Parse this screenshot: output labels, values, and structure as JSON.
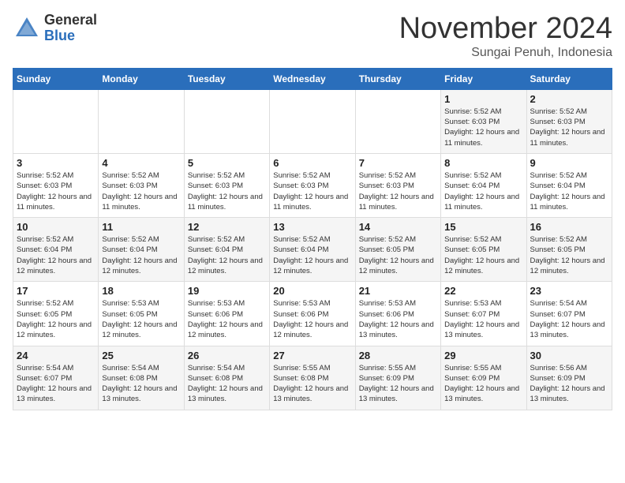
{
  "header": {
    "logo_general": "General",
    "logo_blue": "Blue",
    "month_title": "November 2024",
    "subtitle": "Sungai Penuh, Indonesia"
  },
  "days_of_week": [
    "Sunday",
    "Monday",
    "Tuesday",
    "Wednesday",
    "Thursday",
    "Friday",
    "Saturday"
  ],
  "weeks": [
    [
      {
        "day": "",
        "info": ""
      },
      {
        "day": "",
        "info": ""
      },
      {
        "day": "",
        "info": ""
      },
      {
        "day": "",
        "info": ""
      },
      {
        "day": "",
        "info": ""
      },
      {
        "day": "1",
        "info": "Sunrise: 5:52 AM\nSunset: 6:03 PM\nDaylight: 12 hours\nand 11 minutes."
      },
      {
        "day": "2",
        "info": "Sunrise: 5:52 AM\nSunset: 6:03 PM\nDaylight: 12 hours\nand 11 minutes."
      }
    ],
    [
      {
        "day": "3",
        "info": "Sunrise: 5:52 AM\nSunset: 6:03 PM\nDaylight: 12 hours\nand 11 minutes."
      },
      {
        "day": "4",
        "info": "Sunrise: 5:52 AM\nSunset: 6:03 PM\nDaylight: 12 hours\nand 11 minutes."
      },
      {
        "day": "5",
        "info": "Sunrise: 5:52 AM\nSunset: 6:03 PM\nDaylight: 12 hours\nand 11 minutes."
      },
      {
        "day": "6",
        "info": "Sunrise: 5:52 AM\nSunset: 6:03 PM\nDaylight: 12 hours\nand 11 minutes."
      },
      {
        "day": "7",
        "info": "Sunrise: 5:52 AM\nSunset: 6:03 PM\nDaylight: 12 hours\nand 11 minutes."
      },
      {
        "day": "8",
        "info": "Sunrise: 5:52 AM\nSunset: 6:04 PM\nDaylight: 12 hours\nand 11 minutes."
      },
      {
        "day": "9",
        "info": "Sunrise: 5:52 AM\nSunset: 6:04 PM\nDaylight: 12 hours\nand 11 minutes."
      }
    ],
    [
      {
        "day": "10",
        "info": "Sunrise: 5:52 AM\nSunset: 6:04 PM\nDaylight: 12 hours\nand 12 minutes."
      },
      {
        "day": "11",
        "info": "Sunrise: 5:52 AM\nSunset: 6:04 PM\nDaylight: 12 hours\nand 12 minutes."
      },
      {
        "day": "12",
        "info": "Sunrise: 5:52 AM\nSunset: 6:04 PM\nDaylight: 12 hours\nand 12 minutes."
      },
      {
        "day": "13",
        "info": "Sunrise: 5:52 AM\nSunset: 6:04 PM\nDaylight: 12 hours\nand 12 minutes."
      },
      {
        "day": "14",
        "info": "Sunrise: 5:52 AM\nSunset: 6:05 PM\nDaylight: 12 hours\nand 12 minutes."
      },
      {
        "day": "15",
        "info": "Sunrise: 5:52 AM\nSunset: 6:05 PM\nDaylight: 12 hours\nand 12 minutes."
      },
      {
        "day": "16",
        "info": "Sunrise: 5:52 AM\nSunset: 6:05 PM\nDaylight: 12 hours\nand 12 minutes."
      }
    ],
    [
      {
        "day": "17",
        "info": "Sunrise: 5:52 AM\nSunset: 6:05 PM\nDaylight: 12 hours\nand 12 minutes."
      },
      {
        "day": "18",
        "info": "Sunrise: 5:53 AM\nSunset: 6:05 PM\nDaylight: 12 hours\nand 12 minutes."
      },
      {
        "day": "19",
        "info": "Sunrise: 5:53 AM\nSunset: 6:06 PM\nDaylight: 12 hours\nand 12 minutes."
      },
      {
        "day": "20",
        "info": "Sunrise: 5:53 AM\nSunset: 6:06 PM\nDaylight: 12 hours\nand 12 minutes."
      },
      {
        "day": "21",
        "info": "Sunrise: 5:53 AM\nSunset: 6:06 PM\nDaylight: 12 hours\nand 13 minutes."
      },
      {
        "day": "22",
        "info": "Sunrise: 5:53 AM\nSunset: 6:07 PM\nDaylight: 12 hours\nand 13 minutes."
      },
      {
        "day": "23",
        "info": "Sunrise: 5:54 AM\nSunset: 6:07 PM\nDaylight: 12 hours\nand 13 minutes."
      }
    ],
    [
      {
        "day": "24",
        "info": "Sunrise: 5:54 AM\nSunset: 6:07 PM\nDaylight: 12 hours\nand 13 minutes."
      },
      {
        "day": "25",
        "info": "Sunrise: 5:54 AM\nSunset: 6:08 PM\nDaylight: 12 hours\nand 13 minutes."
      },
      {
        "day": "26",
        "info": "Sunrise: 5:54 AM\nSunset: 6:08 PM\nDaylight: 12 hours\nand 13 minutes."
      },
      {
        "day": "27",
        "info": "Sunrise: 5:55 AM\nSunset: 6:08 PM\nDaylight: 12 hours\nand 13 minutes."
      },
      {
        "day": "28",
        "info": "Sunrise: 5:55 AM\nSunset: 6:09 PM\nDaylight: 12 hours\nand 13 minutes."
      },
      {
        "day": "29",
        "info": "Sunrise: 5:55 AM\nSunset: 6:09 PM\nDaylight: 12 hours\nand 13 minutes."
      },
      {
        "day": "30",
        "info": "Sunrise: 5:56 AM\nSunset: 6:09 PM\nDaylight: 12 hours\nand 13 minutes."
      }
    ]
  ]
}
